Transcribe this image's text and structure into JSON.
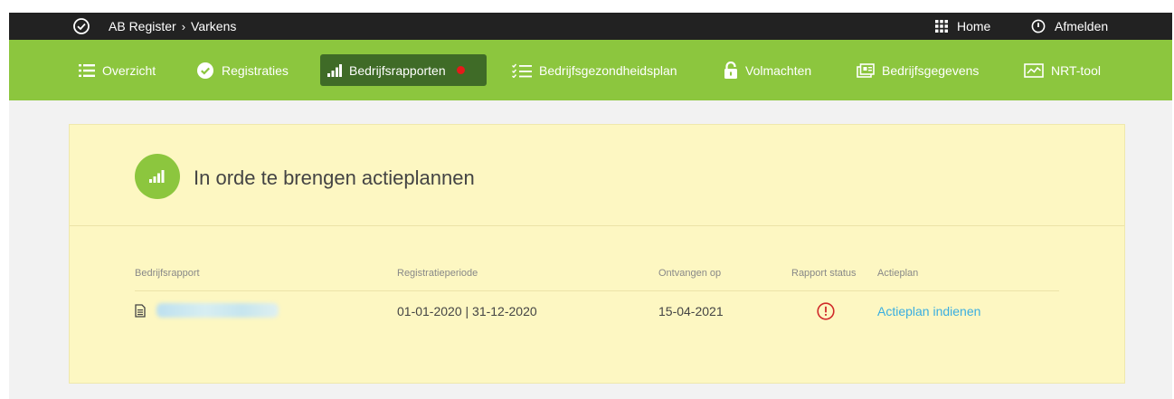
{
  "topbar": {
    "breadcrumb": [
      "AB Register",
      "Varkens"
    ],
    "breadcrumb_separator": "›",
    "home_label": "Home",
    "logout_label": "Afmelden"
  },
  "nav": {
    "items": [
      {
        "label": "Overzicht",
        "icon": "list-icon"
      },
      {
        "label": "Registraties",
        "icon": "check-circle-icon"
      },
      {
        "label": "Bedrijfsrapporten",
        "icon": "signal-bars-icon",
        "active": true,
        "notification": true
      },
      {
        "label": "Bedrijfsgezondheidsplan",
        "icon": "checklist-icon"
      },
      {
        "label": "Volmachten",
        "icon": "lock-icon"
      },
      {
        "label": "Bedrijfsgegevens",
        "icon": "documents-icon"
      },
      {
        "label": "NRT-tool",
        "icon": "chart-window-icon"
      }
    ]
  },
  "card": {
    "title": "In orde te brengen actieplannen",
    "columns": [
      "Bedrijfsrapport",
      "Registratieperiode",
      "Ontvangen op",
      "Rapport status",
      "Actieplan"
    ],
    "rows": [
      {
        "report": "",
        "period": "01-01-2020 | 31-12-2020",
        "received": "15-04-2021",
        "status_icon": "alert-circle-icon",
        "action": "Actieplan indienen"
      }
    ]
  },
  "colors": {
    "topbar": "#222222",
    "nav_green": "#8cc63e",
    "nav_active": "#3f6b27",
    "card_bg": "#fdf7c2",
    "link": "#3aaee0",
    "alert": "#d02a2a"
  }
}
